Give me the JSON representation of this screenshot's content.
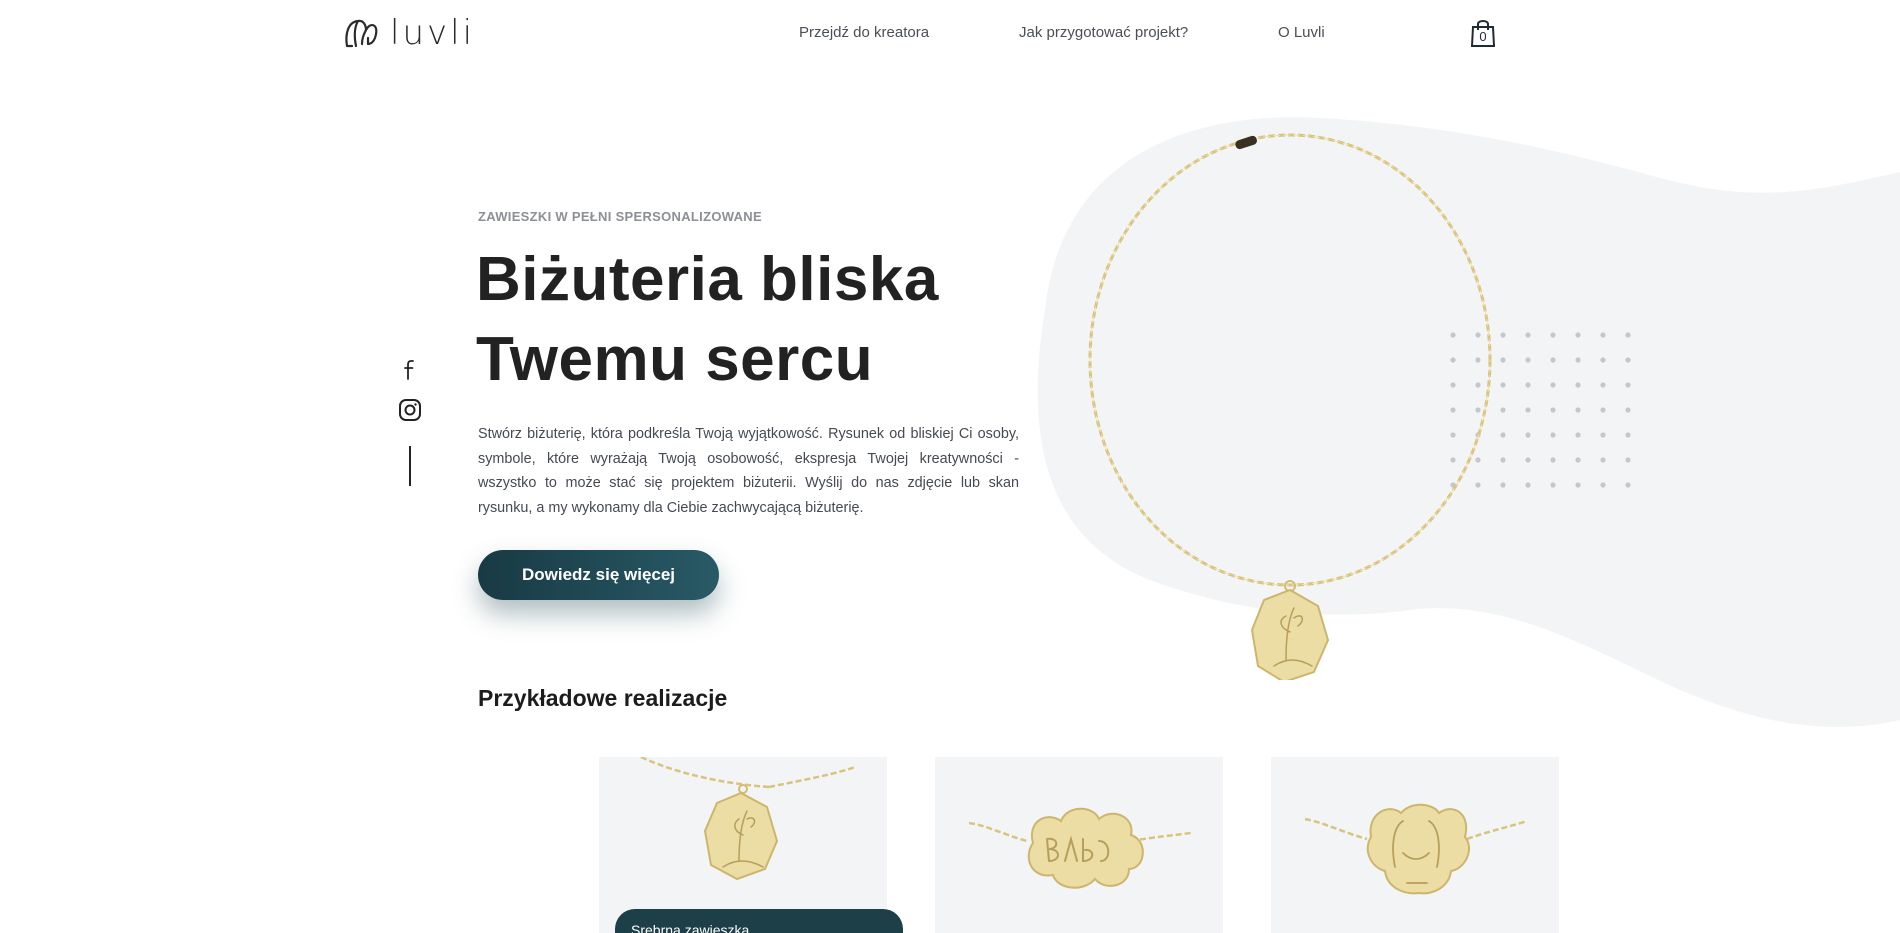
{
  "header": {
    "logo_text": "luvli",
    "nav": [
      "Przejdź do kreatora",
      "Jak przygotować projekt?",
      "O Luvli"
    ],
    "cart_count": "0"
  },
  "hero": {
    "eyebrow": "ZAWIESZKI W PEŁNI SPERSONALIZOWANE",
    "title_line1": "Biżuteria bliska",
    "title_line2": "Twemu sercu",
    "description": "Stwórz biżuterię, która podkreśla Twoją wyjątkowość. Rysunek od bliskiej Ci osoby, symbole, które wyrażają Twoją osobowość, ekspresja Twojej kreatywności - wszystko to może stać się projektem biżuterii. Wyślij do nas zdjęcie lub skan rysunku, a my wykonamy dla Ciebie zachwycającą biżuterię.",
    "cta_label": "Dowiedz się więcej"
  },
  "examples": {
    "title": "Przykładowe realizacje",
    "cards": [
      {
        "label": "Srebrna zawieszka"
      },
      {
        "label": ""
      },
      {
        "label": ""
      }
    ]
  },
  "colors": {
    "accent": "#1d3f47",
    "gold": "#e9d79a",
    "blob": "#f2f4f5"
  }
}
